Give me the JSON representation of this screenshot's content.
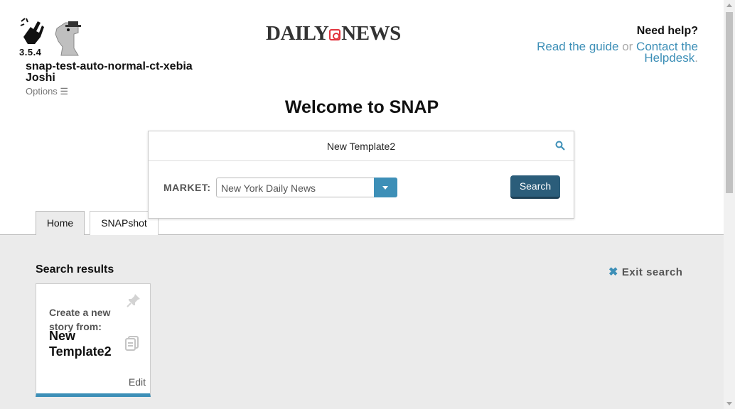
{
  "header": {
    "version": "3.5.4",
    "username": "snap-test-auto-normal-ct-xebia Joshi",
    "options_label": "Options ☰",
    "masthead_left": "DAILY",
    "masthead_right": "NEWS",
    "help_title": "Need help?",
    "help_guide_link": "Read the guide",
    "help_or": "or",
    "help_helpdesk_link": "Contact the Helpdesk",
    "help_period": "."
  },
  "welcome_title": "Welcome to SNAP",
  "search": {
    "query": "New Template2",
    "market_label": "MARKET:",
    "market_value": "New York Daily News",
    "button_label": "Search"
  },
  "tabs": [
    {
      "label": "Home",
      "active": true
    },
    {
      "label": "SNAPshot",
      "active": false
    }
  ],
  "results": {
    "title": "Search results",
    "exit_label": "Exit search",
    "cards": [
      {
        "create_label": "Create a new story from:",
        "template_name": "New Template2",
        "edit_label": "Edit"
      }
    ]
  },
  "colors": {
    "accent": "#3d8fb7",
    "button_dark": "#2b5d7a",
    "content_bg": "#ebebeb",
    "masthead_red": "#e2333d"
  },
  "icons": [
    "hand-logo-icon",
    "dog-logo-icon",
    "search-icon",
    "dropdown-caret-icon",
    "close-icon",
    "pin-icon",
    "copy-icon"
  ]
}
